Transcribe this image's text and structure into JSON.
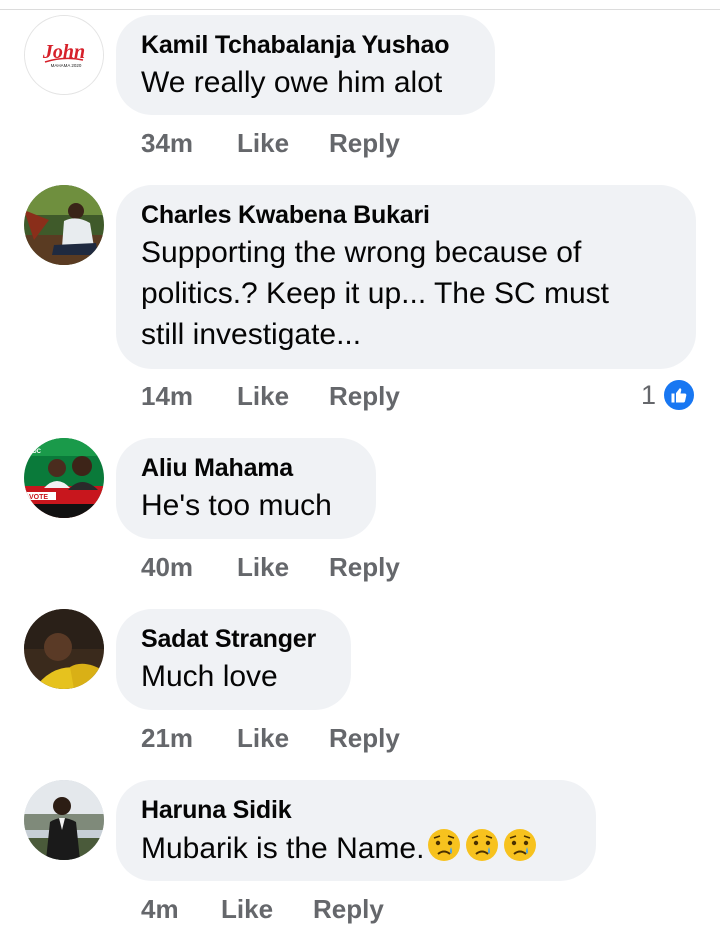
{
  "comments": [
    {
      "author": "Kamil Tchabalanja Yushao",
      "text": "We really owe him alot",
      "time": "34m",
      "like_label": "Like",
      "reply_label": "Reply",
      "avatar_logo_text": "John",
      "avatar_logo_sub": "MAHAMA 2020"
    },
    {
      "author": "Charles Kwabena Bukari",
      "text_lines": [
        "Supporting the wrong because of",
        "politics.? Keep it up... The SC must",
        "still investigate..."
      ],
      "time": "14m",
      "like_label": "Like",
      "reply_label": "Reply",
      "reaction_count": "1"
    },
    {
      "author": "Aliu Mahama",
      "text": "He's too much",
      "time": "40m",
      "like_label": "Like",
      "reply_label": "Reply",
      "avatar_badge_top": "NDC",
      "avatar_badge_bottom": "VOTE"
    },
    {
      "author": "Sadat Stranger",
      "text": "Much love",
      "time": "21m",
      "like_label": "Like",
      "reply_label": "Reply"
    },
    {
      "author": "Haruna Sidik",
      "text": "Mubarik is the Name.",
      "time": "4m",
      "like_label": "Like",
      "reply_label": "Reply"
    }
  ]
}
